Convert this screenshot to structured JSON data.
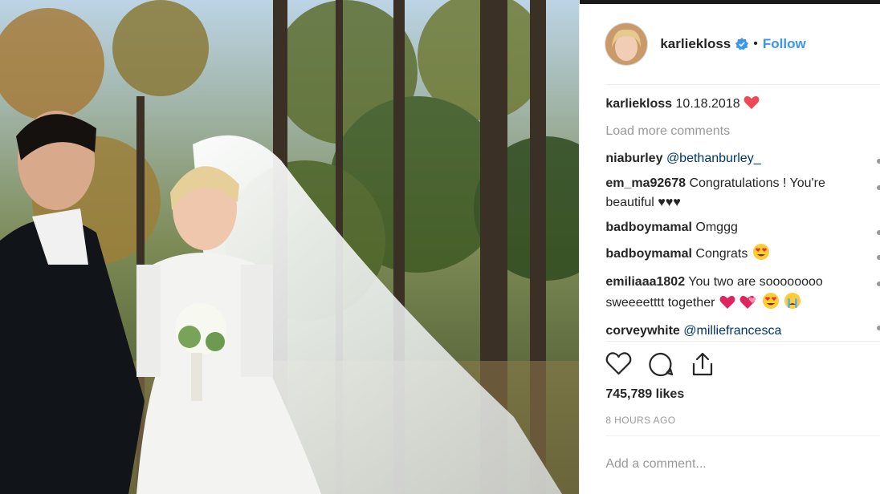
{
  "post": {
    "username": "karliekloss",
    "follow_label": "Follow",
    "separator": "•",
    "verified_icon": "verified-badge-icon",
    "caption": {
      "user": "karliekloss",
      "text": "10.18.2018"
    },
    "load_more": "Load more comments",
    "comments": [
      {
        "user": "niaburley",
        "text": "",
        "mention": "@bethanburley_"
      },
      {
        "user": "em_ma92678",
        "text": "Congratulations ! You're beautiful ♥♥♥",
        "mention": ""
      },
      {
        "user": "badboymamal",
        "text": "Omggg",
        "mention": ""
      },
      {
        "user": "badboymamal",
        "text": "Congrats",
        "mention": ""
      },
      {
        "user": "emiliaaa1802",
        "text": "You two are soooooooo sweeeetttt together",
        "mention": ""
      },
      {
        "user": "corveywhite",
        "text": "",
        "mention": "@milliefrancesca"
      }
    ],
    "likes": "745,789 likes",
    "time": "8 HOURS AGO",
    "add_comment_placeholder": "Add a comment...",
    "colors": {
      "link": "#3897f0",
      "mention": "#003569",
      "heart": "#ed4956",
      "muted": "#999999"
    }
  }
}
